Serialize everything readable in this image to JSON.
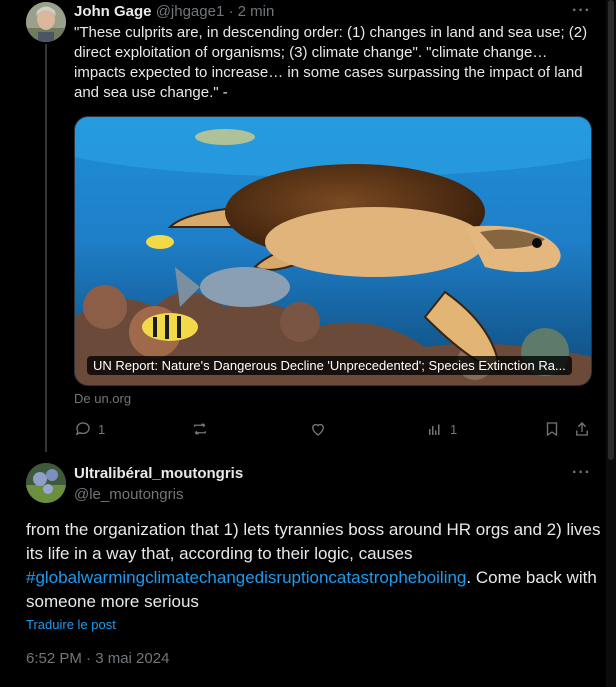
{
  "tweet_original": {
    "author_name": "John Gage",
    "author_handle": "@jhgage1",
    "time_sep": " · ",
    "time": "2 min",
    "text": "\"These culprits are, in descending order: (1) changes in land and sea use; (2) direct exploitation of organisms; (3) climate change\". \"climate change… impacts expected to increase… in some cases surpassing the impact of land and sea use change.\" -",
    "link_card": {
      "title": "UN Report: Nature's Dangerous Decline 'Unprecedented'; Species Extinction Ra...",
      "source": "De un.org"
    },
    "actions": {
      "reply_count": "1",
      "retweet_count": "",
      "like_count": "",
      "views_count": "1"
    },
    "icons": [
      "more-icon",
      "reply-icon",
      "retweet-icon",
      "like-icon",
      "views-icon",
      "bookmark-icon",
      "share-icon"
    ]
  },
  "tweet_reply": {
    "author_name": "Ultralibéral_moutongris",
    "author_handle": "@le_moutongris",
    "text_before": "from the organization that 1) lets tyrannies boss around HR orgs and 2) lives its life in a way that, according to their logic, causes ",
    "hashtag": "#globalwarmingclimatechangedisruptioncatastropheboiling",
    "text_after": ". Come back with someone more serious",
    "translate_label": "Traduire le post",
    "timestamp": "6:52 PM · 3 mai 2024"
  },
  "colors": {
    "background": "#000000",
    "text_primary": "#e7e9ea",
    "text_secondary": "#71767b",
    "accent": "#1d9bf0",
    "border": "#2f3336"
  }
}
